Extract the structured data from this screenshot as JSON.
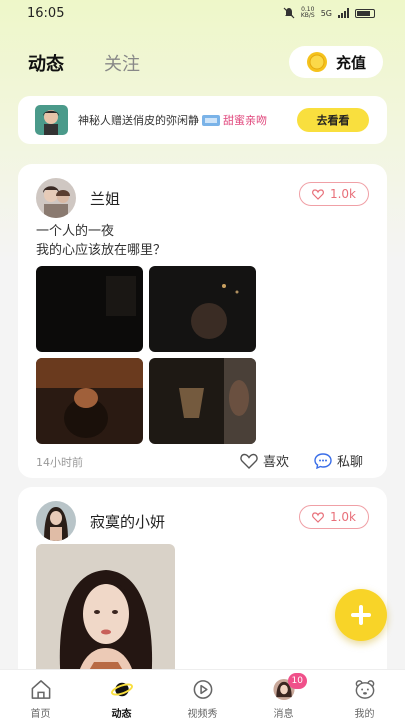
{
  "status_bar": {
    "time": "16:05",
    "net_speed_value": "0.10",
    "net_speed_unit": "KB/S",
    "signal": "5G"
  },
  "top_tabs": {
    "active": "动态",
    "inactive": "关注"
  },
  "recharge": {
    "label": "充值"
  },
  "notice": {
    "text_before": "神秘人赠送俏皮的弥闲静",
    "text_highlight": "甜蜜亲吻",
    "button": "去看看"
  },
  "posts": [
    {
      "username": "兰姐",
      "likes": "1.0k",
      "lines": [
        "一个人的一夜",
        "我的心应该放在哪里？"
      ],
      "time": "14小时前",
      "like_action": "喜欢",
      "chat_action": "私聊"
    },
    {
      "username": "寂寞的小妍",
      "likes": "1.0k"
    }
  ],
  "bottom_nav": {
    "items": [
      {
        "label": "首页"
      },
      {
        "label": "动态"
      },
      {
        "label": "视频秀"
      },
      {
        "label": "消息",
        "badge": "10"
      },
      {
        "label": "我的"
      }
    ]
  },
  "colors": {
    "accent_yellow": "#f9df3e",
    "like_pink": "#e8707a",
    "badge_pink": "#f0508a"
  }
}
